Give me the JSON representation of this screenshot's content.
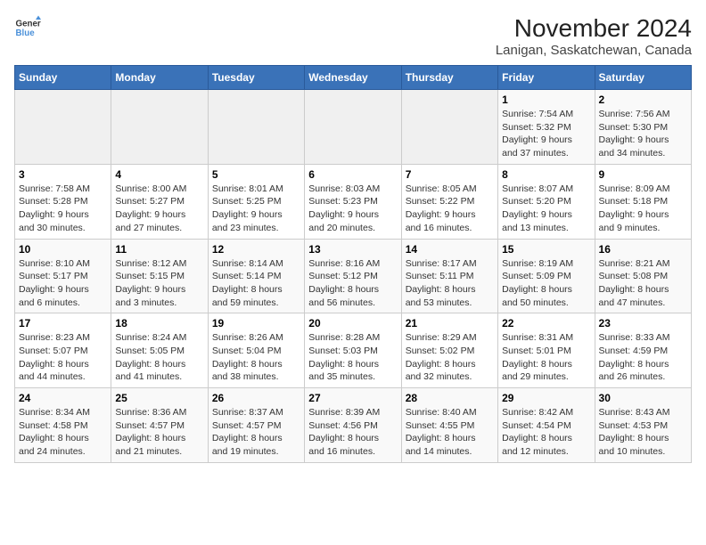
{
  "logo": {
    "line1": "General",
    "line2": "Blue"
  },
  "title": "November 2024",
  "subtitle": "Lanigan, Saskatchewan, Canada",
  "weekdays": [
    "Sunday",
    "Monday",
    "Tuesday",
    "Wednesday",
    "Thursday",
    "Friday",
    "Saturday"
  ],
  "weeks": [
    [
      {
        "day": "",
        "info": ""
      },
      {
        "day": "",
        "info": ""
      },
      {
        "day": "",
        "info": ""
      },
      {
        "day": "",
        "info": ""
      },
      {
        "day": "",
        "info": ""
      },
      {
        "day": "1",
        "info": "Sunrise: 7:54 AM\nSunset: 5:32 PM\nDaylight: 9 hours\nand 37 minutes."
      },
      {
        "day": "2",
        "info": "Sunrise: 7:56 AM\nSunset: 5:30 PM\nDaylight: 9 hours\nand 34 minutes."
      }
    ],
    [
      {
        "day": "3",
        "info": "Sunrise: 7:58 AM\nSunset: 5:28 PM\nDaylight: 9 hours\nand 30 minutes."
      },
      {
        "day": "4",
        "info": "Sunrise: 8:00 AM\nSunset: 5:27 PM\nDaylight: 9 hours\nand 27 minutes."
      },
      {
        "day": "5",
        "info": "Sunrise: 8:01 AM\nSunset: 5:25 PM\nDaylight: 9 hours\nand 23 minutes."
      },
      {
        "day": "6",
        "info": "Sunrise: 8:03 AM\nSunset: 5:23 PM\nDaylight: 9 hours\nand 20 minutes."
      },
      {
        "day": "7",
        "info": "Sunrise: 8:05 AM\nSunset: 5:22 PM\nDaylight: 9 hours\nand 16 minutes."
      },
      {
        "day": "8",
        "info": "Sunrise: 8:07 AM\nSunset: 5:20 PM\nDaylight: 9 hours\nand 13 minutes."
      },
      {
        "day": "9",
        "info": "Sunrise: 8:09 AM\nSunset: 5:18 PM\nDaylight: 9 hours\nand 9 minutes."
      }
    ],
    [
      {
        "day": "10",
        "info": "Sunrise: 8:10 AM\nSunset: 5:17 PM\nDaylight: 9 hours\nand 6 minutes."
      },
      {
        "day": "11",
        "info": "Sunrise: 8:12 AM\nSunset: 5:15 PM\nDaylight: 9 hours\nand 3 minutes."
      },
      {
        "day": "12",
        "info": "Sunrise: 8:14 AM\nSunset: 5:14 PM\nDaylight: 8 hours\nand 59 minutes."
      },
      {
        "day": "13",
        "info": "Sunrise: 8:16 AM\nSunset: 5:12 PM\nDaylight: 8 hours\nand 56 minutes."
      },
      {
        "day": "14",
        "info": "Sunrise: 8:17 AM\nSunset: 5:11 PM\nDaylight: 8 hours\nand 53 minutes."
      },
      {
        "day": "15",
        "info": "Sunrise: 8:19 AM\nSunset: 5:09 PM\nDaylight: 8 hours\nand 50 minutes."
      },
      {
        "day": "16",
        "info": "Sunrise: 8:21 AM\nSunset: 5:08 PM\nDaylight: 8 hours\nand 47 minutes."
      }
    ],
    [
      {
        "day": "17",
        "info": "Sunrise: 8:23 AM\nSunset: 5:07 PM\nDaylight: 8 hours\nand 44 minutes."
      },
      {
        "day": "18",
        "info": "Sunrise: 8:24 AM\nSunset: 5:05 PM\nDaylight: 8 hours\nand 41 minutes."
      },
      {
        "day": "19",
        "info": "Sunrise: 8:26 AM\nSunset: 5:04 PM\nDaylight: 8 hours\nand 38 minutes."
      },
      {
        "day": "20",
        "info": "Sunrise: 8:28 AM\nSunset: 5:03 PM\nDaylight: 8 hours\nand 35 minutes."
      },
      {
        "day": "21",
        "info": "Sunrise: 8:29 AM\nSunset: 5:02 PM\nDaylight: 8 hours\nand 32 minutes."
      },
      {
        "day": "22",
        "info": "Sunrise: 8:31 AM\nSunset: 5:01 PM\nDaylight: 8 hours\nand 29 minutes."
      },
      {
        "day": "23",
        "info": "Sunrise: 8:33 AM\nSunset: 4:59 PM\nDaylight: 8 hours\nand 26 minutes."
      }
    ],
    [
      {
        "day": "24",
        "info": "Sunrise: 8:34 AM\nSunset: 4:58 PM\nDaylight: 8 hours\nand 24 minutes."
      },
      {
        "day": "25",
        "info": "Sunrise: 8:36 AM\nSunset: 4:57 PM\nDaylight: 8 hours\nand 21 minutes."
      },
      {
        "day": "26",
        "info": "Sunrise: 8:37 AM\nSunset: 4:57 PM\nDaylight: 8 hours\nand 19 minutes."
      },
      {
        "day": "27",
        "info": "Sunrise: 8:39 AM\nSunset: 4:56 PM\nDaylight: 8 hours\nand 16 minutes."
      },
      {
        "day": "28",
        "info": "Sunrise: 8:40 AM\nSunset: 4:55 PM\nDaylight: 8 hours\nand 14 minutes."
      },
      {
        "day": "29",
        "info": "Sunrise: 8:42 AM\nSunset: 4:54 PM\nDaylight: 8 hours\nand 12 minutes."
      },
      {
        "day": "30",
        "info": "Sunrise: 8:43 AM\nSunset: 4:53 PM\nDaylight: 8 hours\nand 10 minutes."
      }
    ]
  ]
}
